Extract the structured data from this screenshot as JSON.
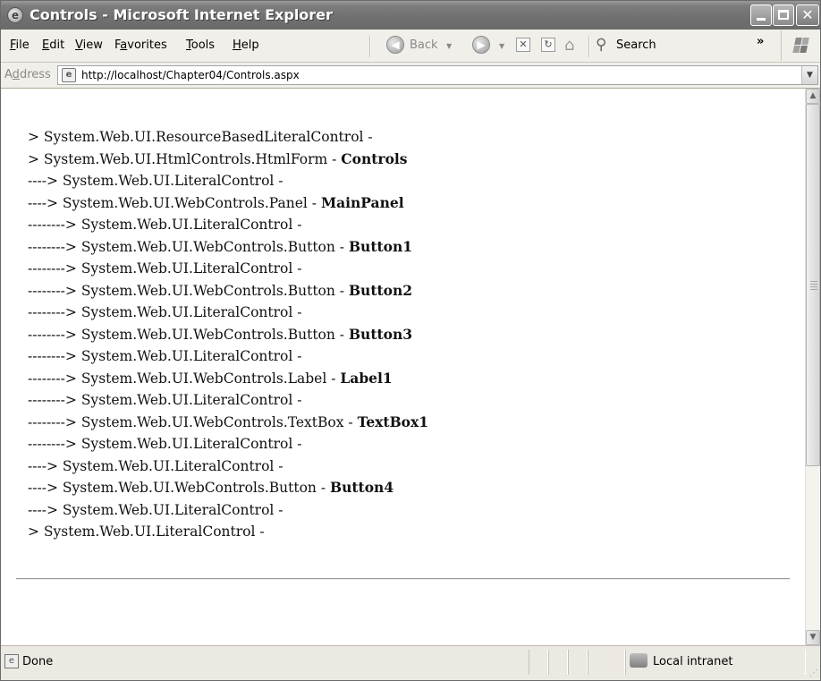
{
  "window": {
    "title": "Controls - Microsoft Internet Explorer"
  },
  "menu": {
    "file": {
      "accel": "F",
      "rest": "ile"
    },
    "edit": {
      "accel": "E",
      "rest": "dit"
    },
    "view": {
      "accel": "V",
      "rest": "iew"
    },
    "favorites": {
      "pre": "F",
      "accel": "a",
      "rest": "vorites"
    },
    "tools": {
      "accel": "T",
      "rest": "ools"
    },
    "help": {
      "accel": "H",
      "rest": "elp"
    }
  },
  "toolbar": {
    "back_label": "Back",
    "search_label": "Search",
    "more_chevron": "»"
  },
  "address": {
    "label_pre": "A",
    "label_accel": "d",
    "label_rest": "dress",
    "url": "http://localhost/Chapter04/Controls.aspx"
  },
  "content": {
    "lines": [
      {
        "prefix": "> System.Web.UI.ResourceBasedLiteralControl - ",
        "id": ""
      },
      {
        "prefix": "> System.Web.UI.HtmlControls.HtmlForm - ",
        "id": "Controls"
      },
      {
        "prefix": "----> System.Web.UI.LiteralControl - ",
        "id": ""
      },
      {
        "prefix": "----> System.Web.UI.WebControls.Panel - ",
        "id": "MainPanel"
      },
      {
        "prefix": "--------> System.Web.UI.LiteralControl - ",
        "id": ""
      },
      {
        "prefix": "--------> System.Web.UI.WebControls.Button - ",
        "id": "Button1"
      },
      {
        "prefix": "--------> System.Web.UI.LiteralControl - ",
        "id": ""
      },
      {
        "prefix": "--------> System.Web.UI.WebControls.Button - ",
        "id": "Button2"
      },
      {
        "prefix": "--------> System.Web.UI.LiteralControl - ",
        "id": ""
      },
      {
        "prefix": "--------> System.Web.UI.WebControls.Button - ",
        "id": "Button3"
      },
      {
        "prefix": "--------> System.Web.UI.LiteralControl - ",
        "id": ""
      },
      {
        "prefix": "--------> System.Web.UI.WebControls.Label - ",
        "id": "Label1"
      },
      {
        "prefix": "--------> System.Web.UI.LiteralControl - ",
        "id": ""
      },
      {
        "prefix": "--------> System.Web.UI.WebControls.TextBox - ",
        "id": "TextBox1"
      },
      {
        "prefix": "--------> System.Web.UI.LiteralControl - ",
        "id": ""
      },
      {
        "prefix": "----> System.Web.UI.LiteralControl - ",
        "id": ""
      },
      {
        "prefix": "----> System.Web.UI.WebControls.Button - ",
        "id": "Button4"
      },
      {
        "prefix": "----> System.Web.UI.LiteralControl - ",
        "id": ""
      },
      {
        "prefix": "> System.Web.UI.LiteralControl - ",
        "id": ""
      }
    ]
  },
  "status": {
    "text": "Done",
    "zone": "Local intranet"
  }
}
